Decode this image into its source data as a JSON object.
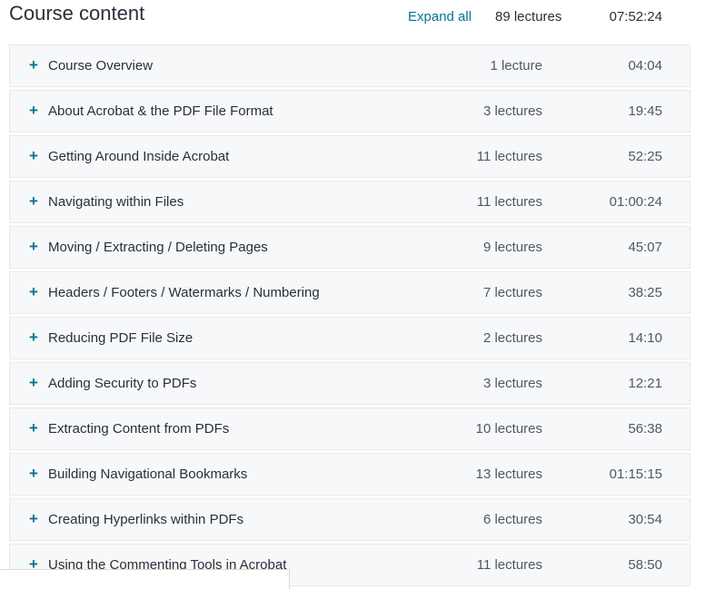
{
  "header": {
    "title": "Course content",
    "expand_all_label": "Expand all",
    "total_lectures": "89 lectures",
    "total_duration": "07:52:24"
  },
  "icons": {
    "expand": "plus-icon"
  },
  "colors": {
    "accent": "#007791",
    "section_bg": "#f7f8fa",
    "section_border": "#e8e9eb",
    "text": "#29303b",
    "muted_text": "#505763"
  },
  "sections": [
    {
      "title": "Course Overview",
      "lectures": "1 lecture",
      "duration": "04:04"
    },
    {
      "title": "About Acrobat & the PDF File Format",
      "lectures": "3 lectures",
      "duration": "19:45"
    },
    {
      "title": "Getting Around Inside Acrobat",
      "lectures": "11 lectures",
      "duration": "52:25"
    },
    {
      "title": "Navigating within Files",
      "lectures": "11 lectures",
      "duration": "01:00:24"
    },
    {
      "title": "Moving / Extracting / Deleting Pages",
      "lectures": "9 lectures",
      "duration": "45:07"
    },
    {
      "title": "Headers / Footers / Watermarks / Numbering",
      "lectures": "7 lectures",
      "duration": "38:25"
    },
    {
      "title": "Reducing PDF File Size",
      "lectures": "2 lectures",
      "duration": "14:10"
    },
    {
      "title": "Adding Security to PDFs",
      "lectures": "3 lectures",
      "duration": "12:21"
    },
    {
      "title": "Extracting Content from PDFs",
      "lectures": "10 lectures",
      "duration": "56:38"
    },
    {
      "title": "Building Navigational Bookmarks",
      "lectures": "13 lectures",
      "duration": "01:15:15"
    },
    {
      "title": "Creating Hyperlinks within PDFs",
      "lectures": "6 lectures",
      "duration": "30:54"
    },
    {
      "title": "Using the Commenting Tools in Acrobat",
      "lectures": "11 lectures",
      "duration": "58:50"
    }
  ]
}
